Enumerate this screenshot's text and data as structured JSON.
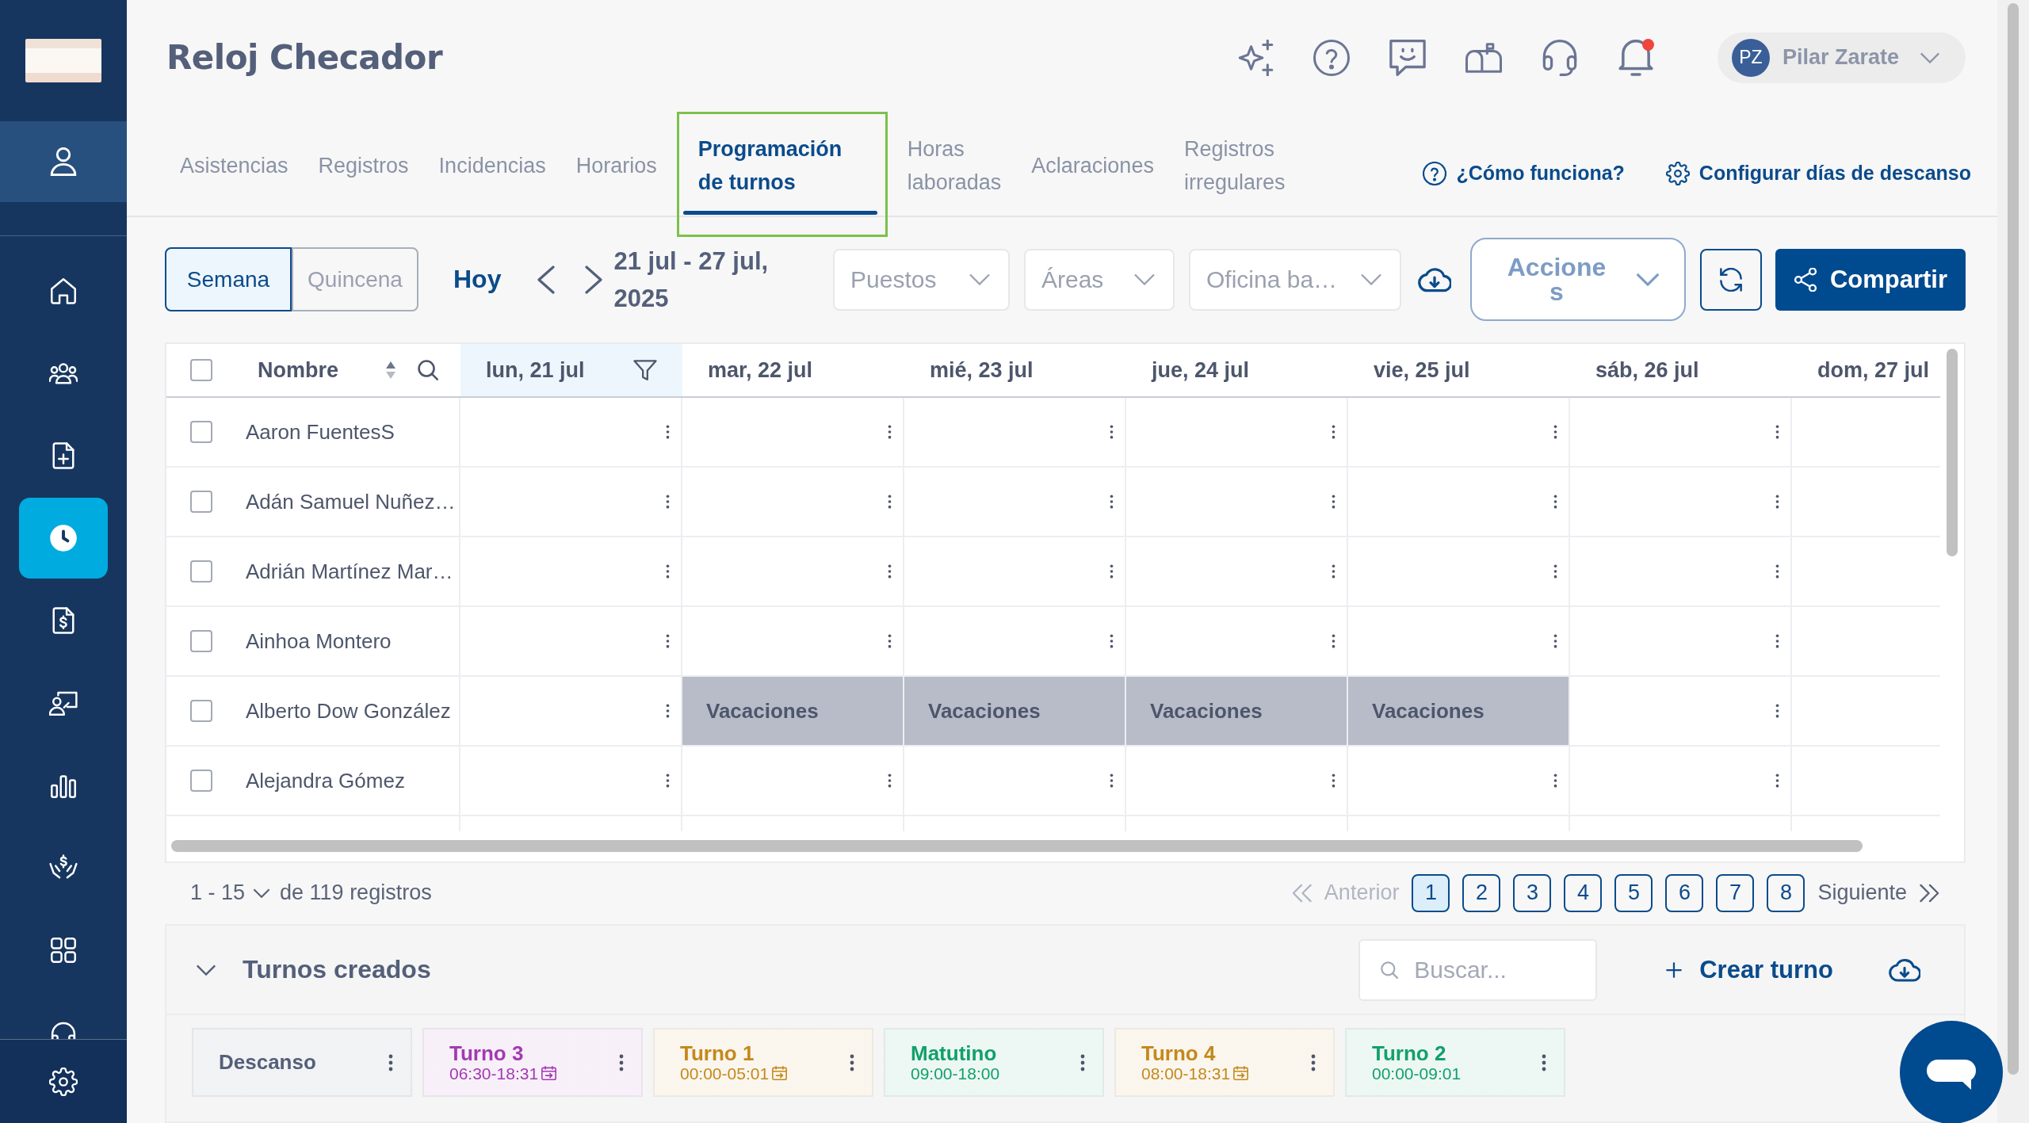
{
  "sidebar": {
    "account_item": {
      "selected": true
    },
    "items": [
      {
        "kind": "home",
        "selected": false
      },
      {
        "kind": "team",
        "selected": false
      },
      {
        "kind": "new_document",
        "selected": false
      },
      {
        "kind": "clock",
        "selected": true
      },
      {
        "kind": "invoice",
        "selected": false
      },
      {
        "kind": "presenter",
        "selected": false
      },
      {
        "kind": "chart",
        "selected": false
      },
      {
        "kind": "payroll",
        "selected": false
      },
      {
        "kind": "apps",
        "selected": false
      },
      {
        "kind": "support",
        "selected": false
      }
    ]
  },
  "header": {
    "title": "Reloj Checador",
    "notification_dot": true,
    "user": {
      "initials": "PZ",
      "name": "Pilar Zarate"
    }
  },
  "tabs": [
    {
      "label": "Asistencias",
      "selected": false
    },
    {
      "label": "Registros",
      "selected": false
    },
    {
      "label": "Incidencias",
      "selected": false
    },
    {
      "label": "Horarios",
      "selected": false
    },
    {
      "label": "Programación de turnos",
      "selected": true
    },
    {
      "label": "Horas laboradas",
      "selected": false
    },
    {
      "label": "Aclaraciones",
      "selected": false
    },
    {
      "label": "Registros irregulares",
      "selected": false
    }
  ],
  "help_links": [
    {
      "kind": "help",
      "label": "¿Cómo funciona?"
    },
    {
      "kind": "settings",
      "label": "Configurar días de descanso"
    }
  ],
  "toolbar": {
    "period": [
      {
        "label": "Semana",
        "selected": true
      },
      {
        "label": "Quincena",
        "selected": false
      }
    ],
    "today": "Hoy",
    "date_range": "21 jul - 27 jul, 2025",
    "filters": [
      {
        "placeholder": "Puestos"
      },
      {
        "placeholder": "Áreas"
      },
      {
        "placeholder": "Oficina ba…"
      }
    ],
    "actions": "Acciones",
    "share": "Compartir"
  },
  "table": {
    "select_all_checked": false,
    "name_header": "Nombre",
    "columns": [
      {
        "label": "lun, 21 jul",
        "highlighted": true
      },
      {
        "label": "mar, 22 jul",
        "highlighted": false
      },
      {
        "label": "mié, 23 jul",
        "highlighted": false
      },
      {
        "label": "jue, 24 jul",
        "highlighted": false
      },
      {
        "label": "vie, 25 jul",
        "highlighted": false
      },
      {
        "label": "sáb, 26 jul",
        "highlighted": false
      },
      {
        "label": "dom, 27 jul",
        "highlighted": false
      }
    ],
    "rows": [
      {
        "name": "Aaron FuentesS",
        "checked": false,
        "cells": [
          {
            "kind": "empty",
            "menu_icon": true
          },
          {
            "kind": "empty",
            "menu_icon": true
          },
          {
            "kind": "empty",
            "menu_icon": true
          },
          {
            "kind": "empty",
            "menu_icon": true
          },
          {
            "kind": "empty",
            "menu_icon": true
          },
          {
            "kind": "empty",
            "menu_icon": true
          },
          {
            "kind": "empty",
            "menu_icon": false
          }
        ]
      },
      {
        "name": "Adán Samuel Nuñez…",
        "checked": false,
        "cells": [
          {
            "kind": "empty",
            "menu_icon": true
          },
          {
            "kind": "empty",
            "menu_icon": true
          },
          {
            "kind": "empty",
            "menu_icon": true
          },
          {
            "kind": "empty",
            "menu_icon": true
          },
          {
            "kind": "empty",
            "menu_icon": true
          },
          {
            "kind": "empty",
            "menu_icon": true
          },
          {
            "kind": "empty",
            "menu_icon": false
          }
        ]
      },
      {
        "name": "Adrián Martínez Mar…",
        "checked": false,
        "cells": [
          {
            "kind": "empty",
            "menu_icon": true
          },
          {
            "kind": "empty",
            "menu_icon": true
          },
          {
            "kind": "empty",
            "menu_icon": true
          },
          {
            "kind": "empty",
            "menu_icon": true
          },
          {
            "kind": "empty",
            "menu_icon": true
          },
          {
            "kind": "empty",
            "menu_icon": true
          },
          {
            "kind": "empty",
            "menu_icon": false
          }
        ]
      },
      {
        "name": "Ainhoa Montero",
        "checked": false,
        "cells": [
          {
            "kind": "empty",
            "menu_icon": true
          },
          {
            "kind": "empty",
            "menu_icon": true
          },
          {
            "kind": "empty",
            "menu_icon": true
          },
          {
            "kind": "empty",
            "menu_icon": true
          },
          {
            "kind": "empty",
            "menu_icon": true
          },
          {
            "kind": "empty",
            "menu_icon": true
          },
          {
            "kind": "empty",
            "menu_icon": false
          }
        ]
      },
      {
        "name": "Alberto Dow González",
        "checked": false,
        "cells": [
          {
            "kind": "empty",
            "menu_icon": true
          },
          {
            "kind": "vacation",
            "text": "Vacaciones"
          },
          {
            "kind": "vacation",
            "text": "Vacaciones"
          },
          {
            "kind": "vacation",
            "text": "Vacaciones"
          },
          {
            "kind": "vacation",
            "text": "Vacaciones"
          },
          {
            "kind": "empty",
            "menu_icon": true
          },
          {
            "kind": "empty",
            "menu_icon": false
          }
        ]
      },
      {
        "name": "Alejandra Gómez",
        "checked": false,
        "cells": [
          {
            "kind": "empty",
            "menu_icon": true
          },
          {
            "kind": "empty",
            "menu_icon": true
          },
          {
            "kind": "empty",
            "menu_icon": true
          },
          {
            "kind": "empty",
            "menu_icon": true
          },
          {
            "kind": "empty",
            "menu_icon": true
          },
          {
            "kind": "empty",
            "menu_icon": true
          },
          {
            "kind": "empty",
            "menu_icon": false
          }
        ]
      }
    ]
  },
  "pagination": {
    "range": "1 - 15",
    "total": "de 119 registros",
    "previous": {
      "label": "Anterior",
      "disabled": true
    },
    "pages": [
      {
        "label": "1",
        "selected": true
      },
      {
        "label": "2",
        "selected": false
      },
      {
        "label": "3",
        "selected": false
      },
      {
        "label": "4",
        "selected": false
      },
      {
        "label": "5",
        "selected": false
      },
      {
        "label": "6",
        "selected": false
      },
      {
        "label": "7",
        "selected": false
      },
      {
        "label": "8",
        "selected": false
      }
    ],
    "next": {
      "label": "Siguiente",
      "disabled": false
    }
  },
  "shifts_panel": {
    "title": "Turnos creados",
    "expanded": true,
    "search": {
      "placeholder": "Buscar..."
    },
    "create_button": "Crear turno",
    "shifts": [
      {
        "name": "Descanso",
        "calendar_icon": false,
        "color": "#545f7a"
      },
      {
        "name": "Turno 3",
        "time": "06:30-18:31",
        "calendar_icon": true,
        "color": "#a33ab3"
      },
      {
        "name": "Turno 1",
        "time": "00:00-05:01",
        "calendar_icon": true,
        "color": "#c4891c"
      },
      {
        "name": "Matutino",
        "time": "09:00-18:00",
        "calendar_icon": false,
        "color": "#12a06b"
      },
      {
        "name": "Turno 4",
        "time": "08:00-18:31",
        "calendar_icon": true,
        "color": "#c4891c"
      },
      {
        "name": "Turno 2",
        "time": "00:00-09:01",
        "calendar_icon": false,
        "color": "#12a06b"
      }
    ]
  }
}
